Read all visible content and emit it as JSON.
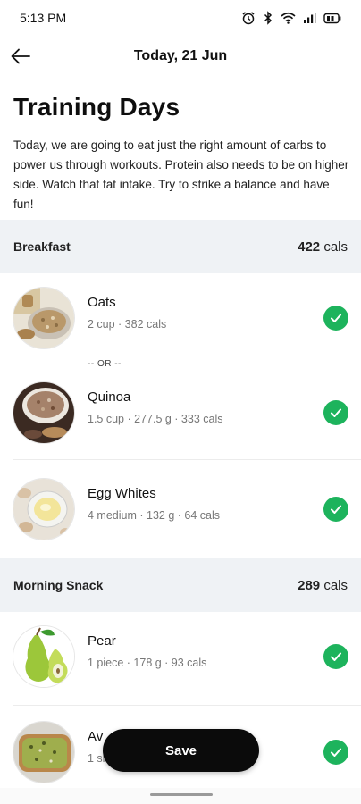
{
  "status_bar": {
    "time": "5:13 PM",
    "icons": [
      "alarm-icon",
      "bluetooth-icon",
      "wifi-icon",
      "signal-icon",
      "battery-icon"
    ]
  },
  "header": {
    "title": "Today, 21 Jun",
    "back_icon": "arrow-left-icon"
  },
  "page": {
    "title": "Training Days",
    "intro": "Today, we are going to eat just the right amount of carbs to power us through workouts. Protein also needs to be on higher side. Watch that fat intake. Try to strike a balance and have fun!"
  },
  "sections": {
    "breakfast": {
      "name": "Breakfast",
      "cals_value": "422",
      "cals_unit": "cals",
      "or_label": "-- OR --",
      "items": [
        {
          "name": "Oats",
          "meta": "2 cup  ·  382 cals",
          "checked": true
        },
        {
          "name": "Quinoa",
          "meta": "1.5 cup  ·  277.5 g  ·  333 cals",
          "checked": true
        },
        {
          "name": "Egg Whites",
          "meta": "4 medium  ·  132 g  ·  64 cals",
          "checked": true
        }
      ]
    },
    "morning_snack": {
      "name": "Morning Snack",
      "cals_value": "289",
      "cals_unit": "cals",
      "items": [
        {
          "name": "Pear",
          "meta": "1 piece  ·  178 g  ·  93 cals",
          "checked": true
        },
        {
          "name": "Av",
          "meta": "1 sl",
          "checked": true
        }
      ]
    }
  },
  "actions": {
    "save_label": "Save"
  },
  "colors": {
    "accent_green": "#1db35c",
    "section_bg": "#eff2f5",
    "save_bg": "#0b0b0b"
  }
}
